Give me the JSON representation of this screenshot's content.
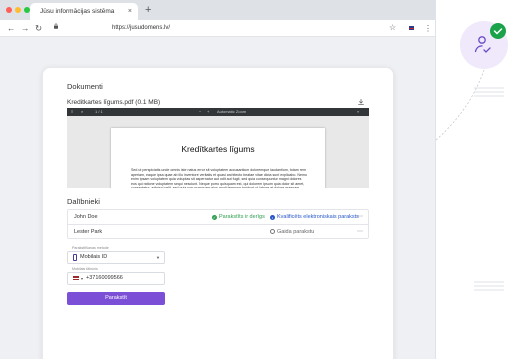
{
  "browser": {
    "tab_title": "Jūsu informācijas sistēma",
    "tab_close": "×",
    "new_tab": "+",
    "url": "https://jusudomens.lv/",
    "nav": {
      "back": "←",
      "forward": "→",
      "reload": "↻"
    },
    "star": "☆",
    "menu": "⋮",
    "colors": {
      "close": "#ff5f57",
      "minimize": "#febc2e",
      "maximize": "#28c840"
    }
  },
  "documents": {
    "heading": "Dokumenti",
    "file_name": "Kreditkartes līgums.pdf (0.1 MB)",
    "viewer_controls": {
      "menu": "≡",
      "file": "File",
      "pages": "1 / 1",
      "zoom": "Automatic Zoom",
      "more": "»"
    },
    "page_title": "Kredītkartes līgums",
    "page_body": "Sed ut perspiciatis unde omnis iste natus error sit voluptatem accusantium doloremque laudantium, totam rem aperiam, eaque ipsa quae ab illo inventore veritatis et quasi architecto beatae vitae dicta sunt explicabo. Nemo enim ipsam voluptatem quia voluptas sit aspernatur aut odit aut fugit, sed quia consequuntur magni dolores eos qui ratione voluptatem sequi nesciunt. Neque porro quisquam est, qui dolorem ipsum quia dolor sit amet, consectetur, adipisci velit, sed quia non numquam eius modi tempora incidunt ut labore et dolore magnam aliquam quaerat voluptatem."
  },
  "participants": {
    "heading": "Dalībnieki",
    "rows": [
      {
        "name": "John Doe",
        "status": "Parakstīts ir derīgs",
        "status_icon": "check-circle-icon",
        "type": "Kvalificēts elektroniskais paraksts",
        "type_icon": "person-badge-icon",
        "more": "⋯"
      },
      {
        "name": "Lester Park",
        "status": "",
        "status_icon": "",
        "type": "Gaida parakstu",
        "type_icon": "clock-icon",
        "more": "⋯"
      }
    ]
  },
  "form": {
    "method_label": "Paraksttīšanas metode",
    "method_value": "Mobilais ID",
    "phone_label": "Mobilais tālrunis",
    "country_code": "▾",
    "phone_value": "+37160099566",
    "submit_label": "Parakstīt"
  },
  "colors": {
    "accent": "#7b4fd6",
    "success": "#2e9d4f",
    "link": "#2756c9",
    "badge": "#1aa34a",
    "deco_circle": "#efe9fb"
  }
}
